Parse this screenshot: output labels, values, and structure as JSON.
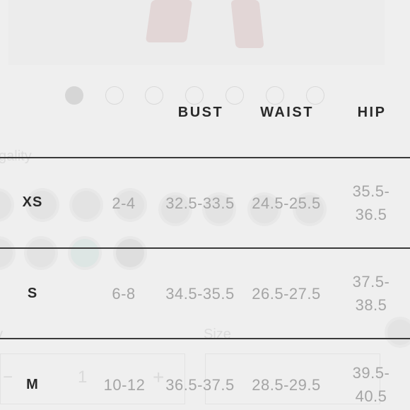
{
  "background": {
    "label_fragment": "gality",
    "size_label": "Size",
    "quantity": "1",
    "plus": "+",
    "minus": "−"
  },
  "chart": {
    "headers": [
      "BUST",
      "WAIST",
      "HIP"
    ],
    "rows": [
      {
        "size": "XS",
        "numeric": "2-4",
        "bust": "32.5-33.5",
        "waist": "24.5-25.5",
        "hip_top": "35.5-",
        "hip_bottom": "36.5"
      },
      {
        "size": "S",
        "numeric": "6-8",
        "bust": "34.5-35.5",
        "waist": "26.5-27.5",
        "hip_top": "37.5-",
        "hip_bottom": "38.5"
      },
      {
        "size": "M",
        "numeric": "10-12",
        "bust": "36.5-37.5",
        "waist": "28.5-29.5",
        "hip_top": "39.5-",
        "hip_bottom": "40.5"
      }
    ]
  }
}
